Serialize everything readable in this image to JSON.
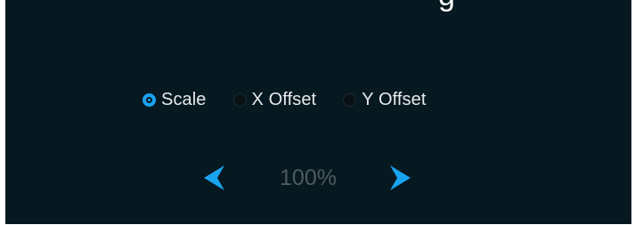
{
  "header": {
    "partial_title_glyph": "g"
  },
  "mode_options": [
    {
      "label": "Scale",
      "selected": true
    },
    {
      "label": "X Offset",
      "selected": false
    },
    {
      "label": "Y Offset",
      "selected": false
    }
  ],
  "stepper": {
    "value": "100%",
    "decrease_icon": "chevron-left-icon",
    "increase_icon": "chevron-right-icon"
  },
  "colors": {
    "background": "#061820",
    "accent": "#1aa3f0",
    "label_text": "#e7eaec",
    "value_text": "#4e5a61"
  }
}
